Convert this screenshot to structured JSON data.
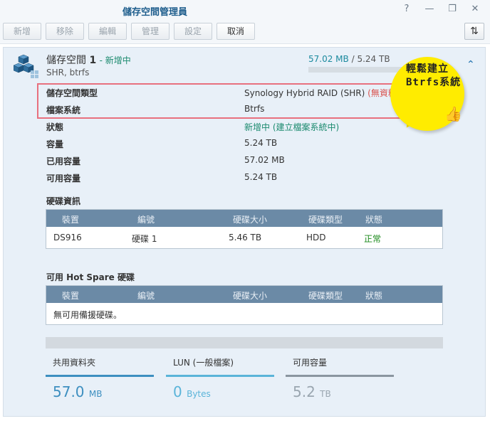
{
  "window": {
    "title": "儲存空間管理員"
  },
  "toolbar": {
    "create": "新增",
    "remove": "移除",
    "edit": "編輯",
    "manage": "管理",
    "settings": "設定",
    "cancel": "取消"
  },
  "volume": {
    "name": "儲存空間",
    "number": "1",
    "status": "- 新增中",
    "subtitle": "SHR, btrfs",
    "used": "57.02 MB",
    "separator": "/",
    "total": "5.24 TB",
    "usage_fraction": 0.0
  },
  "properties": [
    {
      "label": "儲存空間類型",
      "value": "Synology Hybrid RAID (SHR)",
      "extra": "(無資料保護)"
    },
    {
      "label": "檔案系統",
      "value": "Btrfs",
      "extra": ""
    },
    {
      "label": "狀態",
      "value": "新增中 (建立檔案系統中)",
      "extra": ""
    },
    {
      "label": "容量",
      "value": "5.24 TB",
      "extra": ""
    },
    {
      "label": "已用容量",
      "value": "57.02 MB",
      "extra": ""
    },
    {
      "label": "可用容量",
      "value": "5.24 TB",
      "extra": ""
    }
  ],
  "annotation": {
    "text": "輕鬆建立Btrfs系統"
  },
  "disk_section": {
    "title": "硬碟資訊",
    "headers": [
      "裝置",
      "編號",
      "硬碟大小",
      "硬碟類型",
      "狀態"
    ],
    "rows": [
      [
        "DS916",
        "硬碟 1",
        "5.46 TB",
        "HDD",
        "正常"
      ]
    ]
  },
  "hotspare_section": {
    "title": "可用 Hot Spare 硬碟",
    "headers": [
      "裝置",
      "編號",
      "硬碟大小",
      "硬碟類型",
      "狀態"
    ],
    "empty_text": "無可用備援硬碟。"
  },
  "stats": [
    {
      "label": "共用資料夾",
      "value": "57.0",
      "unit": "MB",
      "color": "#3d8fc0"
    },
    {
      "label": "LUN (一般檔案)",
      "value": "0",
      "unit": "Bytes",
      "color": "#5ab4d9"
    },
    {
      "label": "可用容量",
      "value": "5.2",
      "unit": "TB",
      "color": "#8a96a0"
    }
  ],
  "colors": {
    "accent": "#1d5d8c",
    "status_green": "#1b8a6e",
    "warning_red": "#d9534f",
    "table_header": "#6b8aa6"
  }
}
